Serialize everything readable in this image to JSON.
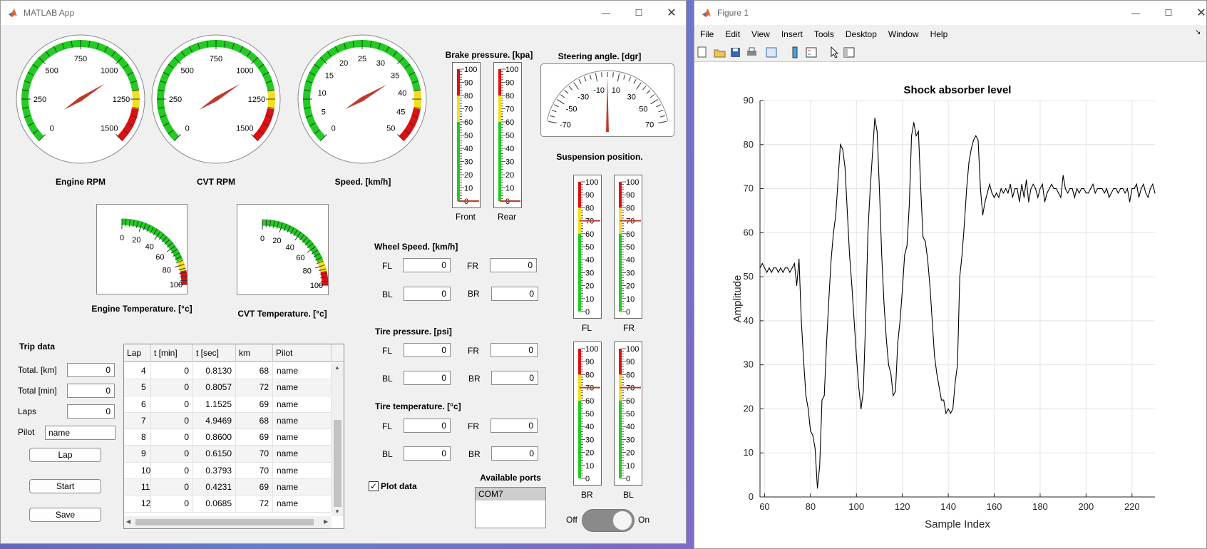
{
  "app": {
    "title": "MATLAB App",
    "figure_title": "Figure 1"
  },
  "gauges": [
    {
      "id": "engine-rpm",
      "label": "Engine RPM",
      "ticks": [
        "0",
        "250",
        "500",
        "750",
        "1000",
        "1250",
        "1500"
      ],
      "min": 0,
      "max": 1500,
      "value": 1070
    },
    {
      "id": "cvt-rpm",
      "label": "CVT RPM",
      "ticks": [
        "0",
        "250",
        "500",
        "750",
        "1000",
        "1250",
        "1500"
      ],
      "min": 0,
      "max": 1500,
      "value": 1070
    },
    {
      "id": "speed",
      "label": "Speed. [km/h]",
      "ticks": [
        "0",
        "5",
        "10",
        "15",
        "20",
        "25",
        "30",
        "35",
        "40",
        "45",
        "50"
      ],
      "min": 0,
      "max": 50,
      "value": 36
    }
  ],
  "temps": [
    {
      "id": "engine-temp",
      "label": "Engine Temperature. [°c]",
      "ticks": [
        "0",
        "20",
        "40",
        "60",
        "80",
        "100"
      ],
      "value": 0
    },
    {
      "id": "cvt-temp",
      "label": "CVT Temperature. [°c]",
      "ticks": [
        "0",
        "20",
        "40",
        "60",
        "80",
        "100"
      ],
      "value": 0
    }
  ],
  "brake": {
    "title": "Brake pressure. [kpa]",
    "gauges": [
      {
        "label": "Front",
        "value": 0
      },
      {
        "label": "Rear",
        "value": 0
      }
    ],
    "ticks": [
      "100",
      "90",
      "80",
      "70",
      "60",
      "50",
      "40",
      "30",
      "20",
      "10",
      "0"
    ]
  },
  "steering": {
    "title": "Steering angle. [dgr]",
    "ticks": [
      "-70",
      "-50",
      "-30",
      "-10",
      "10",
      "30",
      "50",
      "70"
    ],
    "value": 0
  },
  "suspension": {
    "title": "Suspension position.",
    "gauges": [
      {
        "label": "FL",
        "value": 70
      },
      {
        "label": "FR",
        "value": 70
      },
      {
        "label": "BR",
        "value": 70
      },
      {
        "label": "BL",
        "value": 70
      }
    ],
    "ticks": [
      "100",
      "90",
      "80",
      "70",
      "60",
      "50",
      "40",
      "30",
      "20",
      "10",
      "0"
    ]
  },
  "wheel_speed": {
    "title": "Wheel Speed. [km/h]",
    "fields": [
      {
        "label": "FL",
        "value": "0"
      },
      {
        "label": "FR",
        "value": "0"
      },
      {
        "label": "BL",
        "value": "0"
      },
      {
        "label": "BR",
        "value": "0"
      }
    ]
  },
  "tire_pressure": {
    "title": "Tire pressure. [psi]",
    "fields": [
      {
        "label": "FL",
        "value": "0"
      },
      {
        "label": "FR",
        "value": "0"
      },
      {
        "label": "BL",
        "value": "0"
      },
      {
        "label": "BR",
        "value": "0"
      }
    ]
  },
  "tire_temp": {
    "title": "Tire temperature. [°c]",
    "fields": [
      {
        "label": "FL",
        "value": "0"
      },
      {
        "label": "FR",
        "value": "0"
      },
      {
        "label": "BL",
        "value": "0"
      },
      {
        "label": "BR",
        "value": "0"
      }
    ]
  },
  "trip": {
    "title": "Trip data",
    "total_km_label": "Total. [km]",
    "total_km": "0",
    "total_min_label": "Total [min]",
    "total_min": "0",
    "laps_label": "Laps",
    "laps": "0",
    "pilot_label": "Pilot",
    "pilot": "name",
    "lap_btn": "Lap",
    "start_btn": "Start",
    "save_btn": "Save"
  },
  "table": {
    "headers": [
      "Lap",
      "t [min]",
      "t [sec]",
      "km",
      "Pilot"
    ],
    "rows": [
      [
        "4",
        "0",
        "0.8130",
        "68",
        "name"
      ],
      [
        "5",
        "0",
        "0.8057",
        "72",
        "name"
      ],
      [
        "6",
        "0",
        "1.1525",
        "69",
        "name"
      ],
      [
        "7",
        "0",
        "4.9469",
        "68",
        "name"
      ],
      [
        "8",
        "0",
        "0.8600",
        "69",
        "name"
      ],
      [
        "9",
        "0",
        "0.6150",
        "70",
        "name"
      ],
      [
        "10",
        "0",
        "0.3793",
        "70",
        "name"
      ],
      [
        "11",
        "0",
        "0.4231",
        "69",
        "name"
      ],
      [
        "12",
        "0",
        "0.0685",
        "72",
        "name"
      ]
    ]
  },
  "plot_data": {
    "label": "Plot data",
    "checked": true
  },
  "ports": {
    "title": "Available ports",
    "items": [
      "COM7"
    ]
  },
  "switch": {
    "off": "Off",
    "on": "On",
    "state": "on"
  },
  "figure_menu": [
    "File",
    "Edit",
    "View",
    "Insert",
    "Tools",
    "Desktop",
    "Window",
    "Help"
  ],
  "toolbar_icons": [
    "new-file-icon",
    "open-folder-icon",
    "save-icon",
    "print-icon",
    "link-plot-icon",
    "colorbar-icon",
    "legend-icon",
    "pointer-icon",
    "property-inspector-icon"
  ],
  "chart_data": {
    "type": "line",
    "title": "Shock absorber level",
    "xlabel": "Sample Index",
    "ylabel": "Amplitude",
    "xlim": [
      58,
      230
    ],
    "ylim": [
      0,
      90
    ],
    "xticks": [
      60,
      80,
      100,
      120,
      140,
      160,
      180,
      200,
      220
    ],
    "yticks": [
      0,
      10,
      20,
      30,
      40,
      50,
      60,
      70,
      80,
      90
    ],
    "grid": true,
    "series": [
      {
        "x": [
          58,
          59,
          60,
          61,
          62,
          63,
          64,
          65,
          66,
          67,
          68,
          69,
          70,
          71,
          72,
          73,
          74,
          75,
          76,
          77,
          78,
          79,
          80,
          81,
          82,
          83,
          84,
          85,
          86,
          87,
          88,
          89,
          90,
          91,
          92,
          93,
          94,
          95,
          96,
          97,
          98,
          99,
          100,
          101,
          102,
          103,
          104,
          105,
          106,
          107,
          108,
          109,
          110,
          111,
          112,
          113,
          114,
          115,
          116,
          117,
          118,
          119,
          120,
          121,
          122,
          123,
          124,
          125,
          126,
          127,
          128,
          129,
          130,
          131,
          132,
          133,
          134,
          135,
          136,
          137,
          138,
          139,
          140,
          141,
          142,
          143,
          144,
          145,
          146,
          147,
          148,
          149,
          150,
          151,
          152,
          153,
          154,
          155,
          156,
          157,
          158,
          159,
          160,
          161,
          162,
          163,
          164,
          165,
          166,
          167,
          168,
          169,
          170,
          171,
          172,
          173,
          174,
          175,
          176,
          177,
          178,
          179,
          180,
          181,
          182,
          183,
          184,
          185,
          186,
          187,
          188,
          189,
          190,
          191,
          192,
          193,
          194,
          195,
          196,
          197,
          198,
          199,
          200,
          201,
          202,
          203,
          204,
          205,
          206,
          207,
          208,
          209,
          210,
          211,
          212,
          213,
          214,
          215,
          216,
          217,
          218,
          219,
          220,
          221,
          222,
          223,
          224,
          225,
          226,
          227,
          228,
          229,
          230
        ],
        "y": [
          52,
          53,
          52,
          51,
          52,
          51,
          52,
          52,
          51,
          52,
          51,
          52,
          52,
          51,
          52,
          53,
          48,
          54,
          40,
          31,
          23,
          20,
          15,
          14,
          11,
          2,
          7,
          22,
          23,
          35,
          45,
          54,
          60,
          64,
          72,
          80,
          79,
          75,
          65,
          55,
          48,
          40,
          32,
          25,
          20,
          24,
          40,
          60,
          70,
          78,
          86,
          83,
          70,
          55,
          44,
          36,
          30,
          28,
          23,
          24,
          35,
          40,
          47,
          55,
          57,
          66,
          82,
          85,
          82,
          83,
          70,
          59,
          58,
          54,
          48,
          40,
          32,
          28,
          25,
          22,
          22,
          19,
          20,
          19,
          20,
          26,
          30,
          50,
          55,
          62,
          70,
          76,
          79,
          81,
          82,
          81,
          70,
          64,
          67,
          69,
          71,
          69,
          68,
          69,
          68,
          70,
          69,
          70,
          69,
          71,
          68,
          70,
          70,
          67,
          71,
          68,
          72,
          67,
          70,
          71,
          70,
          68,
          70,
          71,
          67,
          69,
          70,
          71,
          70,
          70,
          69,
          68,
          73,
          70,
          69,
          70,
          70,
          68,
          70,
          69,
          70,
          70,
          69,
          69,
          70,
          71,
          69,
          70,
          70,
          70,
          69,
          70,
          68,
          69,
          70,
          70,
          69,
          70,
          70,
          69,
          70,
          67,
          70,
          70,
          71,
          68,
          70,
          71,
          69,
          68,
          70,
          71,
          69
        ]
      }
    ]
  }
}
